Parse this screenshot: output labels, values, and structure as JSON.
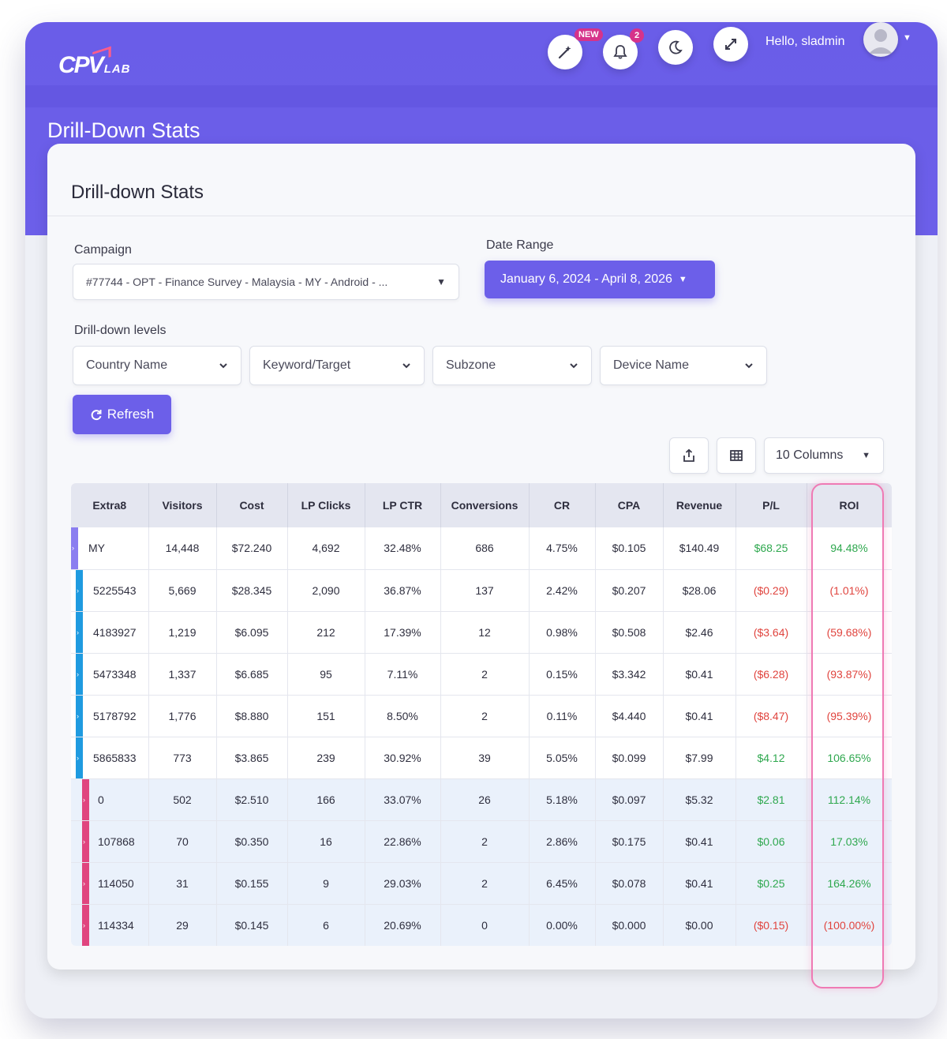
{
  "header": {
    "logo_main": "CPV",
    "logo_sub": "LAB",
    "new_badge": "NEW",
    "notification_count": "2",
    "greeting": "Hello, sladmin"
  },
  "page": {
    "title": "Drill-Down Stats",
    "card_title": "Drill-down Stats"
  },
  "filters": {
    "campaign_label": "Campaign",
    "campaign_value": "#77744 - OPT - Finance Survey - Malaysia - MY - Android - ...",
    "date_label": "Date Range",
    "date_value": "January 6, 2024 - April 8, 2026",
    "levels_label": "Drill-down levels",
    "levels": [
      "Country Name",
      "Keyword/Target",
      "Subzone",
      "Device Name"
    ],
    "refresh_label": "Refresh",
    "columns_label": "10 Columns"
  },
  "table": {
    "columns": [
      "Extra8",
      "Visitors",
      "Cost",
      "LP Clicks",
      "LP CTR",
      "Conversions",
      "CR",
      "CPA",
      "Revenue",
      "P/L",
      "ROI"
    ],
    "rows": [
      {
        "level": 1,
        "cells": [
          "MY",
          "14,448",
          "$72.240",
          "4,692",
          "32.48%",
          "686",
          "4.75%",
          "$0.105",
          "$140.49",
          "$68.25",
          "94.48%"
        ],
        "sign": "pos"
      },
      {
        "level": 2,
        "cells": [
          "5225543",
          "5,669",
          "$28.345",
          "2,090",
          "36.87%",
          "137",
          "2.42%",
          "$0.207",
          "$28.06",
          "($0.29)",
          "(1.01%)"
        ],
        "sign": "neg"
      },
      {
        "level": 2,
        "cells": [
          "4183927",
          "1,219",
          "$6.095",
          "212",
          "17.39%",
          "12",
          "0.98%",
          "$0.508",
          "$2.46",
          "($3.64)",
          "(59.68%)"
        ],
        "sign": "neg"
      },
      {
        "level": 2,
        "cells": [
          "5473348",
          "1,337",
          "$6.685",
          "95",
          "7.11%",
          "2",
          "0.15%",
          "$3.342",
          "$0.41",
          "($6.28)",
          "(93.87%)"
        ],
        "sign": "neg"
      },
      {
        "level": 2,
        "cells": [
          "5178792",
          "1,776",
          "$8.880",
          "151",
          "8.50%",
          "2",
          "0.11%",
          "$4.440",
          "$0.41",
          "($8.47)",
          "(95.39%)"
        ],
        "sign": "neg"
      },
      {
        "level": 2,
        "cells": [
          "5865833",
          "773",
          "$3.865",
          "239",
          "30.92%",
          "39",
          "5.05%",
          "$0.099",
          "$7.99",
          "$4.12",
          "106.65%"
        ],
        "sign": "pos"
      },
      {
        "level": 3,
        "cells": [
          "0",
          "502",
          "$2.510",
          "166",
          "33.07%",
          "26",
          "5.18%",
          "$0.097",
          "$5.32",
          "$2.81",
          "112.14%"
        ],
        "sign": "pos"
      },
      {
        "level": 3,
        "cells": [
          "107868",
          "70",
          "$0.350",
          "16",
          "22.86%",
          "2",
          "2.86%",
          "$0.175",
          "$0.41",
          "$0.06",
          "17.03%"
        ],
        "sign": "pos"
      },
      {
        "level": 3,
        "cells": [
          "114050",
          "31",
          "$0.155",
          "9",
          "29.03%",
          "2",
          "6.45%",
          "$0.078",
          "$0.41",
          "$0.25",
          "164.26%"
        ],
        "sign": "pos"
      },
      {
        "level": 3,
        "cells": [
          "114334",
          "29",
          "$0.145",
          "6",
          "20.69%",
          "0",
          "0.00%",
          "$0.000",
          "$0.00",
          "($0.15)",
          "(100.00%)"
        ],
        "sign": "neg"
      }
    ]
  },
  "colors": {
    "brand": "#6c5fe9",
    "positive": "#2fa84f",
    "negative": "#e0443e",
    "highlight": "#ef7ab4"
  }
}
